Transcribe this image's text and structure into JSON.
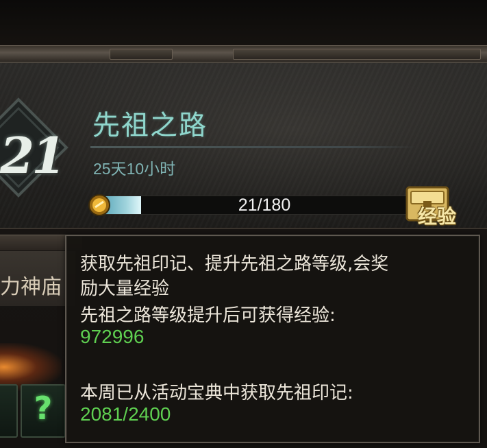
{
  "pass": {
    "level": "21",
    "title": "先祖之路",
    "timer": "25天10小时",
    "progress_text": "21/180",
    "progress_current": 21,
    "progress_max": 180,
    "chest_label": "经验"
  },
  "background": {
    "partial_label": "力神庙"
  },
  "tooltip": {
    "line1": "获取先祖印记、提升先祖之路等级,会奖",
    "line2": "励大量经验",
    "line3": "先祖之路等级提升后可获得经验:",
    "value1": "972996",
    "line4": "本周已从活动宝典中获取先祖印记:",
    "value2": "2081/2400"
  },
  "colors": {
    "title": "#8fd6cc",
    "timer": "#7fb3b3",
    "highlight_value": "#5fd051",
    "progress_fill": "#9fd3dc"
  },
  "icons": {
    "coin": "coin-icon",
    "chest": "treasure-chest-icon",
    "slot": "question-mark-icon"
  }
}
